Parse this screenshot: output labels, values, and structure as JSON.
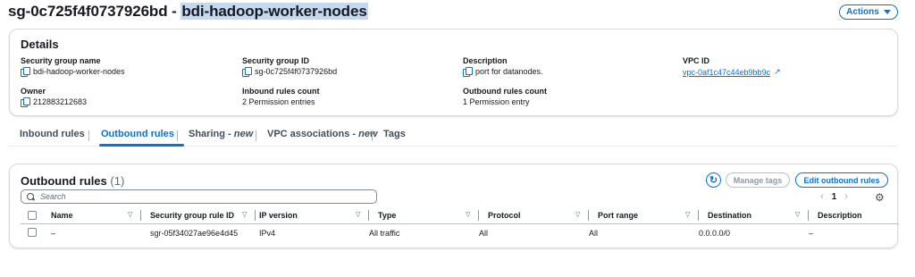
{
  "header": {
    "title_prefix": "sg-0c725f4f0737926bd - ",
    "title_highlight": "bdi-hadoop-worker-nodes",
    "actions_label": "Actions"
  },
  "details": {
    "heading": "Details",
    "security_group_name": {
      "label": "Security group name",
      "value": "bdi-hadoop-worker-nodes"
    },
    "security_group_id": {
      "label": "Security group ID",
      "value": "sg-0c725f4f0737926bd"
    },
    "description": {
      "label": "Description",
      "value": "port for datanodes."
    },
    "vpc_id": {
      "label": "VPC ID",
      "value": "vpc-0af1c47c44eb9bb9c"
    },
    "owner": {
      "label": "Owner",
      "value": "212883212683"
    },
    "inbound_count": {
      "label": "Inbound rules count",
      "value": "2 Permission entries"
    },
    "outbound_count": {
      "label": "Outbound rules count",
      "value": "1 Permission entry"
    }
  },
  "tabs": [
    {
      "label": "Inbound rules",
      "suffix": ""
    },
    {
      "label": "Outbound rules",
      "suffix": ""
    },
    {
      "label": "Sharing - ",
      "suffix": "new"
    },
    {
      "label": "VPC associations - ",
      "suffix": "new"
    },
    {
      "label": "Tags",
      "suffix": ""
    }
  ],
  "outbound": {
    "title": "Outbound rules",
    "count": "(1)",
    "manage_tags_label": "Manage tags",
    "edit_label": "Edit outbound rules",
    "search_placeholder": "Search",
    "page_number": "1",
    "columns": [
      "Name",
      "Security group rule ID",
      "IP version",
      "Type",
      "Protocol",
      "Port range",
      "Destination",
      "Description"
    ],
    "rows": [
      {
        "name": "–",
        "rule_id": "sgr-05f34027ae96e4d45",
        "ip_version": "IPv4",
        "type": "All traffic",
        "protocol": "All",
        "port_range": "All",
        "destination": "0.0.0.0/0",
        "description": "–"
      }
    ]
  }
}
